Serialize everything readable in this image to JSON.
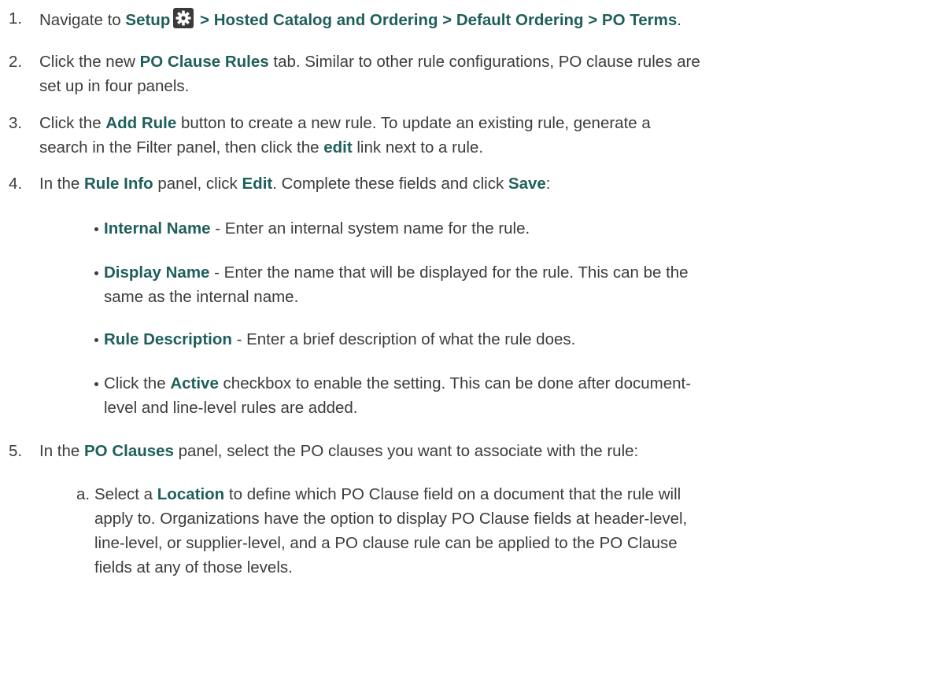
{
  "steps": [
    {
      "num": "1.",
      "lines": [
        {
          "segments": [
            {
              "t": "Navigate to ",
              "b": false
            },
            {
              "t": "Setup",
              "b": true
            },
            {
              "icon": "gear-icon"
            },
            {
              "t": " > Hosted Catalog and Ordering > Default Ordering > PO Terms",
              "b": true
            },
            {
              "t": ".",
              "b": false
            }
          ]
        }
      ]
    },
    {
      "num": "2.",
      "lines": [
        {
          "segments": [
            {
              "t": "Click the new ",
              "b": false
            },
            {
              "t": "PO Clause Rules",
              "b": true
            },
            {
              "t": " tab. Similar to other rule configurations, PO clause rules are",
              "b": false
            }
          ]
        },
        {
          "segments": [
            {
              "t": "set up in four panels.",
              "b": false
            }
          ]
        }
      ]
    },
    {
      "num": "3.",
      "lines": [
        {
          "segments": [
            {
              "t": "Click the ",
              "b": false
            },
            {
              "t": "Add Rule",
              "b": true
            },
            {
              "t": " button to create a new rule. To update an existing rule, generate a",
              "b": false
            }
          ]
        },
        {
          "segments": [
            {
              "t": "search in the Filter panel, then click the ",
              "b": false
            },
            {
              "t": "edit",
              "b": true
            },
            {
              "t": " link next to a rule.",
              "b": false
            }
          ]
        }
      ]
    },
    {
      "num": "4.",
      "lines": [
        {
          "segments": [
            {
              "t": "In the ",
              "b": false
            },
            {
              "t": "Rule Info",
              "b": true
            },
            {
              "t": " panel, click ",
              "b": false
            },
            {
              "t": "Edit",
              "b": true
            },
            {
              "t": ". Complete these fields and click ",
              "b": false
            },
            {
              "t": "Save",
              "b": true
            },
            {
              "t": ":",
              "b": false
            }
          ]
        }
      ]
    },
    {
      "num": "",
      "bullet": true,
      "lines": [
        {
          "segments": [
            {
              "t": "Internal Name",
              "b": true
            },
            {
              "t": " - Enter an internal system name for the rule.",
              "b": false
            }
          ]
        }
      ]
    },
    {
      "num": "",
      "bullet": true,
      "lines": [
        {
          "segments": [
            {
              "t": "Display Name",
              "b": true
            },
            {
              "t": " - Enter the name that will be displayed for the rule. This can be the",
              "b": false
            }
          ]
        },
        {
          "segments": [
            {
              "t": "same as the internal name.",
              "b": false
            }
          ]
        }
      ]
    },
    {
      "num": "",
      "bullet": true,
      "lines": [
        {
          "segments": [
            {
              "t": "Rule Description",
              "b": true
            },
            {
              "t": " - Enter a brief description of what the rule does.",
              "b": false
            }
          ]
        }
      ]
    },
    {
      "num": "",
      "bullet": true,
      "lines": [
        {
          "segments": [
            {
              "t": "Click the ",
              "b": false
            },
            {
              "t": "Active",
              "b": true
            },
            {
              "t": " checkbox to enable the setting. This can be done after document-",
              "b": false
            }
          ]
        },
        {
          "segments": [
            {
              "t": "level and line-level rules are added.",
              "b": false
            }
          ]
        }
      ]
    },
    {
      "num": "5.",
      "lines": [
        {
          "segments": [
            {
              "t": "In the ",
              "b": false
            },
            {
              "t": "PO Clauses",
              "b": true
            },
            {
              "t": " panel, select the PO clauses you want to associate with the rule:",
              "b": false
            }
          ]
        }
      ]
    },
    {
      "num": "a.",
      "sub": true,
      "lines": [
        {
          "segments": [
            {
              "t": "Select a ",
              "b": false
            },
            {
              "t": "Location",
              "b": true
            },
            {
              "t": " to define which PO Clause field on a document that the rule will",
              "b": false
            }
          ]
        },
        {
          "segments": [
            {
              "t": "apply to. Organizations have the option to display PO Clause fields at header-level,",
              "b": false
            }
          ]
        },
        {
          "segments": [
            {
              "t": "line-level, or supplier-level, and a PO clause rule can be applied to the PO Clause",
              "b": false
            }
          ]
        },
        {
          "segments": [
            {
              "t": "fields at any of those levels.",
              "b": false
            }
          ]
        }
      ]
    }
  ]
}
